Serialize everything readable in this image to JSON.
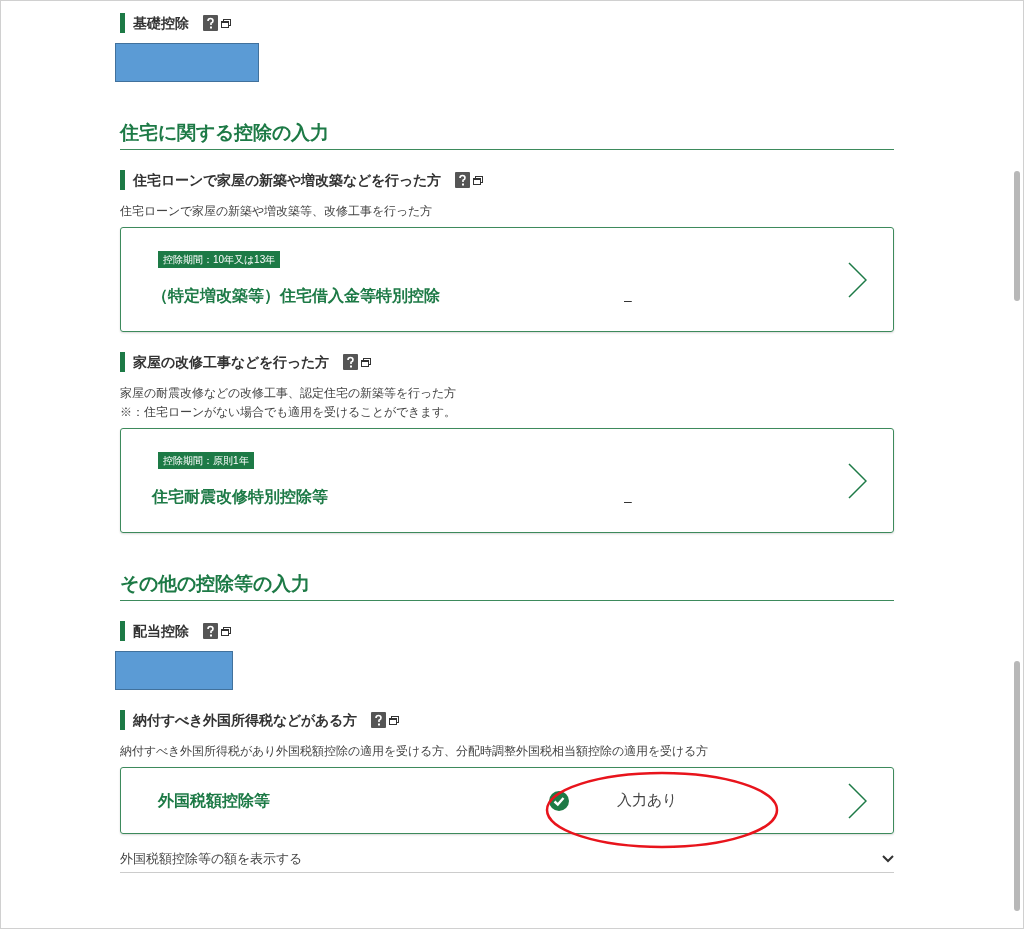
{
  "blocks": [
    {
      "kind": "subheading",
      "title": "基礎控除",
      "redacted": true
    },
    {
      "kind": "heading",
      "title": "住宅に関する控除の入力"
    },
    {
      "kind": "subheading",
      "title": "住宅ローンで家屋の新築や増改築などを行った方",
      "description": "住宅ローンで家屋の新築や増改築等、改修工事を行った方",
      "card": {
        "tag": "控除期間：10年又は13年",
        "title": "（特定増改築等）住宅借入金等特別控除",
        "status": "–",
        "entered": false
      }
    },
    {
      "kind": "subheading",
      "title": "家屋の改修工事などを行った方",
      "description": "家屋の耐震改修などの改修工事、認定住宅の新築等を行った方",
      "note": "※：住宅ローンがない場合でも適用を受けることができます。",
      "card": {
        "tag": "控除期間：原則1年",
        "title": "住宅耐震改修特別控除等",
        "status": "–",
        "entered": false
      }
    },
    {
      "kind": "heading",
      "title": "その他の控除等の入力"
    },
    {
      "kind": "subheading",
      "title": "配当控除",
      "redacted": true
    },
    {
      "kind": "subheading",
      "title": "納付すべき外国所得税などがある方",
      "description": "納付すべき外国所得税があり外国税額控除の適用を受ける方、分配時調整外国税相当額控除の適用を受ける方",
      "card": {
        "title": "外国税額控除等",
        "status": "入力あり",
        "entered": true,
        "circled": true
      },
      "expander": {
        "label": "外国税額控除等の額を表示する",
        "expanded": false
      }
    }
  ]
}
